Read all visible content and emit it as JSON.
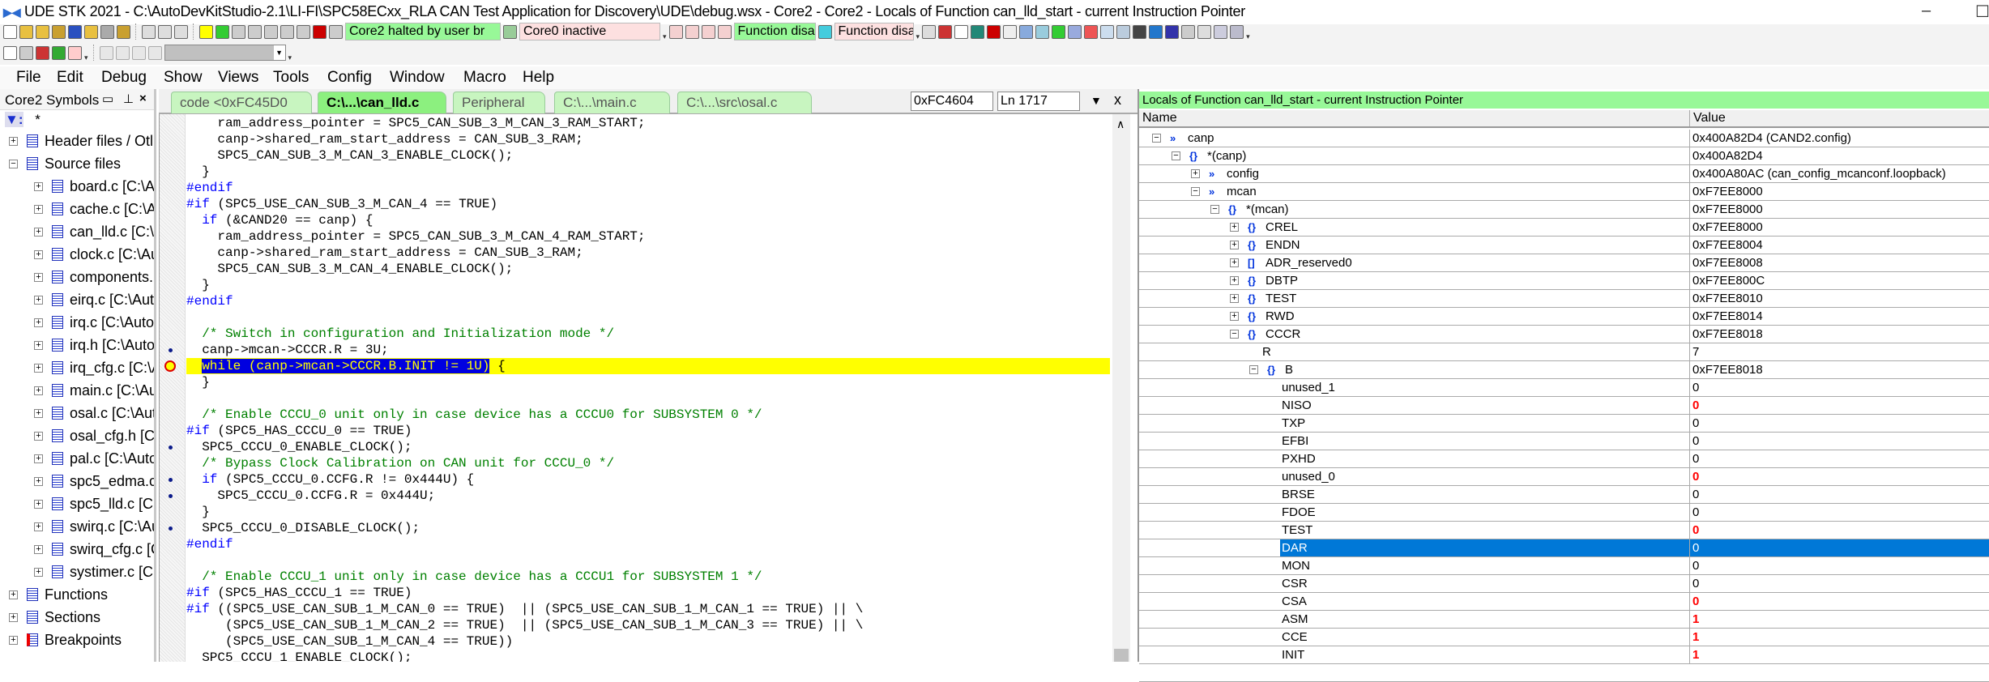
{
  "window": {
    "title": "UDE STK 2021 - C:\\AutoDevKitStudio-2.1\\LI-FI\\SPC58ECxx_RLA CAN Test Application for Discovery\\UDE\\debug.wsx - Core2 - Core2 - Locals of Function can_lld_start - current Instruction Pointer",
    "minimize": "–",
    "maximize": "☐"
  },
  "toolbar": {
    "status_core2": "Core2 halted by user br",
    "status_core0": "Core0 inactive",
    "function_status_1": "Function disa",
    "function_status_2": "Function disa",
    "colors": {
      "green": "#98f898",
      "pink": "#fde0e0"
    }
  },
  "menu": [
    "File",
    "Edit",
    "Debug",
    "Show",
    "Views",
    "Tools",
    "Config",
    "Window",
    "Macro",
    "Help"
  ],
  "symbols_panel": {
    "title": "Core2 Symbols",
    "filter": "*",
    "items": [
      {
        "label": "Header files / Otl",
        "level": 0,
        "exp": "+"
      },
      {
        "label": "Source files",
        "level": 0,
        "exp": "−"
      },
      {
        "label": "board.c [C:\\A",
        "level": 1,
        "exp": "+"
      },
      {
        "label": "cache.c [C:\\Au",
        "level": 1,
        "exp": "+"
      },
      {
        "label": "can_lld.c [C:\\A",
        "level": 1,
        "exp": "+"
      },
      {
        "label": "clock.c [C:\\Au",
        "level": 1,
        "exp": "+"
      },
      {
        "label": "components.",
        "level": 1,
        "exp": "+"
      },
      {
        "label": "eirq.c [C:\\Auto",
        "level": 1,
        "exp": "+"
      },
      {
        "label": "irq.c [C:\\Auto",
        "level": 1,
        "exp": "+"
      },
      {
        "label": "irq.h [C:\\Auto",
        "level": 1,
        "exp": "+"
      },
      {
        "label": "irq_cfg.c [C:\\A",
        "level": 1,
        "exp": "+"
      },
      {
        "label": "main.c [C:\\Au",
        "level": 1,
        "exp": "+"
      },
      {
        "label": "osal.c [C:\\Aut",
        "level": 1,
        "exp": "+"
      },
      {
        "label": "osal_cfg.h [C:\\",
        "level": 1,
        "exp": "+"
      },
      {
        "label": "pal.c [C:\\Auto",
        "level": 1,
        "exp": "+"
      },
      {
        "label": "spc5_edma.c",
        "level": 1,
        "exp": "+"
      },
      {
        "label": "spc5_lld.c [C:\\",
        "level": 1,
        "exp": "+"
      },
      {
        "label": "swirq.c [C:\\Au",
        "level": 1,
        "exp": "+"
      },
      {
        "label": "swirq_cfg.c [C",
        "level": 1,
        "exp": "+"
      },
      {
        "label": "systimer.c [C:\\",
        "level": 1,
        "exp": "+"
      },
      {
        "label": "Functions",
        "level": 0,
        "exp": "+"
      },
      {
        "label": "Sections",
        "level": 0,
        "exp": "+"
      },
      {
        "label": "Breakpoints",
        "level": 0,
        "exp": "+"
      }
    ]
  },
  "editor": {
    "tabs": [
      "code <0xFC45D0",
      "C:\\...\\can_lld.c",
      "Peripheral",
      "C:\\...\\main.c",
      "C:\\...\\src\\osal.c"
    ],
    "active_tab": 1,
    "address": "0xFC4604",
    "line": "Ln 1717",
    "current_line": 15,
    "selected_text": "while (canp->mcan->CCCR.B.INIT != 1U)",
    "lines": [
      {
        "t": "    ram_address_pointer = SPC5_CAN_SUB_3_M_CAN_3_RAM_START;"
      },
      {
        "t": "    canp->shared_ram_start_address = CAN_SUB_3_RAM;"
      },
      {
        "t": "    SPC5_CAN_SUB_3_M_CAN_3_ENABLE_CLOCK();"
      },
      {
        "t": "  }"
      },
      {
        "t": "#endif",
        "c": "kw"
      },
      {
        "t": "#if",
        "c": "kw",
        "r": " (SPC5_USE_CAN_SUB_3_M_CAN_4 == TRUE)"
      },
      {
        "t": "  if",
        "c": "kw",
        "r": " (&CAND20 == canp) {"
      },
      {
        "t": "    ram_address_pointer = SPC5_CAN_SUB_3_M_CAN_4_RAM_START;"
      },
      {
        "t": "    canp->shared_ram_start_address = CAN_SUB_3_RAM;"
      },
      {
        "t": "    SPC5_CAN_SUB_3_M_CAN_4_ENABLE_CLOCK();"
      },
      {
        "t": "  }"
      },
      {
        "t": "#endif",
        "c": "kw"
      },
      {
        "t": ""
      },
      {
        "t": "  /* Switch in configuration and Initialization mode */",
        "c": "cm"
      },
      {
        "t": "  canp->mcan->CCCR.R = 3U;",
        "m": "dot"
      },
      {
        "t": "  ",
        "r": " {",
        "sel": true,
        "m": "arrow"
      },
      {
        "t": "  }"
      },
      {
        "t": ""
      },
      {
        "t": "  /* Enable CCCU_0 unit only in case device has a CCCU0 for SUBSYSTEM 0 */",
        "c": "cm"
      },
      {
        "t": "#if",
        "c": "kw",
        "r": " (SPC5_HAS_CCCU_0 == TRUE)"
      },
      {
        "t": "  SPC5_CCCU_0_ENABLE_CLOCK();",
        "m": "dot"
      },
      {
        "t": "  /* Bypass Clock Calibration on CAN unit for CCCU_0 */",
        "c": "cm"
      },
      {
        "t": "  if",
        "c": "kw",
        "r": " (SPC5_CCCU_0.CCFG.R != 0x444U) {",
        "m": "dot"
      },
      {
        "t": "    SPC5_CCCU_0.CCFG.R = 0x444U;",
        "m": "dot"
      },
      {
        "t": "  }"
      },
      {
        "t": "  SPC5_CCCU_0_DISABLE_CLOCK();",
        "m": "dot"
      },
      {
        "t": "#endif",
        "c": "kw"
      },
      {
        "t": ""
      },
      {
        "t": "  /* Enable CCCU_1 unit only in case device has a CCCU1 for SUBSYSTEM 1 */",
        "c": "cm"
      },
      {
        "t": "#if",
        "c": "kw",
        "r": " (SPC5_HAS_CCCU_1 == TRUE)"
      },
      {
        "t": "#if",
        "c": "kw",
        "r": " ((SPC5_USE_CAN_SUB_1_M_CAN_0 == TRUE)  || (SPC5_USE_CAN_SUB_1_M_CAN_1 == TRUE) || \\"
      },
      {
        "t": "     (SPC5_USE_CAN_SUB_1_M_CAN_2 == TRUE)  || (SPC5_USE_CAN_SUB_1_M_CAN_3 == TRUE) || \\"
      },
      {
        "t": "     (SPC5_USE_CAN_SUB_1_M_CAN_4 == TRUE))"
      },
      {
        "t": "  SPC5_CCCU_1_ENABLE_CLOCK();"
      }
    ]
  },
  "locals": {
    "title": "Locals of Function can_lld_start - current Instruction Pointer",
    "col_name": "Name",
    "col_value": "Value",
    "rows": [
      {
        "name": "canp",
        "value": "0x400A82D4 (CAND2.config)",
        "level": 0,
        "exp": "−",
        "icon": "»"
      },
      {
        "name": "*(canp)",
        "value": "0x400A82D4",
        "level": 1,
        "exp": "−",
        "icon": "{}"
      },
      {
        "name": "config",
        "value": "0x400A80AC (can_config_mcanconf.loopback)",
        "level": 2,
        "exp": "+",
        "icon": "»"
      },
      {
        "name": "mcan",
        "value": "0xF7EE8000",
        "level": 2,
        "exp": "−",
        "icon": "»"
      },
      {
        "name": "*(mcan)",
        "value": "0xF7EE8000",
        "level": 3,
        "exp": "−",
        "icon": "{}"
      },
      {
        "name": "CREL",
        "value": "0xF7EE8000",
        "level": 4,
        "exp": "+",
        "icon": "{}"
      },
      {
        "name": "ENDN",
        "value": "0xF7EE8004",
        "level": 4,
        "exp": "+",
        "icon": "{}"
      },
      {
        "name": "ADR_reserved0",
        "value": "0xF7EE8008",
        "level": 4,
        "exp": "+",
        "icon": "[]"
      },
      {
        "name": "DBTP",
        "value": "0xF7EE800C",
        "level": 4,
        "exp": "+",
        "icon": "{}"
      },
      {
        "name": "TEST",
        "value": "0xF7EE8010",
        "level": 4,
        "exp": "+",
        "icon": "{}"
      },
      {
        "name": "RWD",
        "value": "0xF7EE8014",
        "level": 4,
        "exp": "+",
        "icon": "{}"
      },
      {
        "name": "CCCR",
        "value": "0xF7EE8018",
        "level": 4,
        "exp": "−",
        "icon": "{}"
      },
      {
        "name": "R",
        "value": "7",
        "level": 5
      },
      {
        "name": "B",
        "value": "0xF7EE8018",
        "level": 5,
        "exp": "−",
        "icon": "{}"
      },
      {
        "name": "unused_1",
        "value": "0",
        "level": 6
      },
      {
        "name": "NISO",
        "value": "0",
        "level": 6,
        "changed": true
      },
      {
        "name": "TXP",
        "value": "0",
        "level": 6
      },
      {
        "name": "EFBI",
        "value": "0",
        "level": 6
      },
      {
        "name": "PXHD",
        "value": "0",
        "level": 6
      },
      {
        "name": "unused_0",
        "value": "0",
        "level": 6,
        "changed": true
      },
      {
        "name": "BRSE",
        "value": "0",
        "level": 6
      },
      {
        "name": "FDOE",
        "value": "0",
        "level": 6
      },
      {
        "name": "TEST",
        "value": "0",
        "level": 6,
        "changed": true
      },
      {
        "name": "DAR",
        "value": "0",
        "level": 6,
        "selected": true
      },
      {
        "name": "MON",
        "value": "0",
        "level": 6
      },
      {
        "name": "CSR",
        "value": "0",
        "level": 6
      },
      {
        "name": "CSA",
        "value": "0",
        "level": 6,
        "changed": true
      },
      {
        "name": "ASM",
        "value": "1",
        "level": 6,
        "changed": true
      },
      {
        "name": "CCE",
        "value": "1",
        "level": 6,
        "changed": true
      },
      {
        "name": "INIT",
        "value": "1",
        "level": 6,
        "changed": true
      }
    ]
  }
}
